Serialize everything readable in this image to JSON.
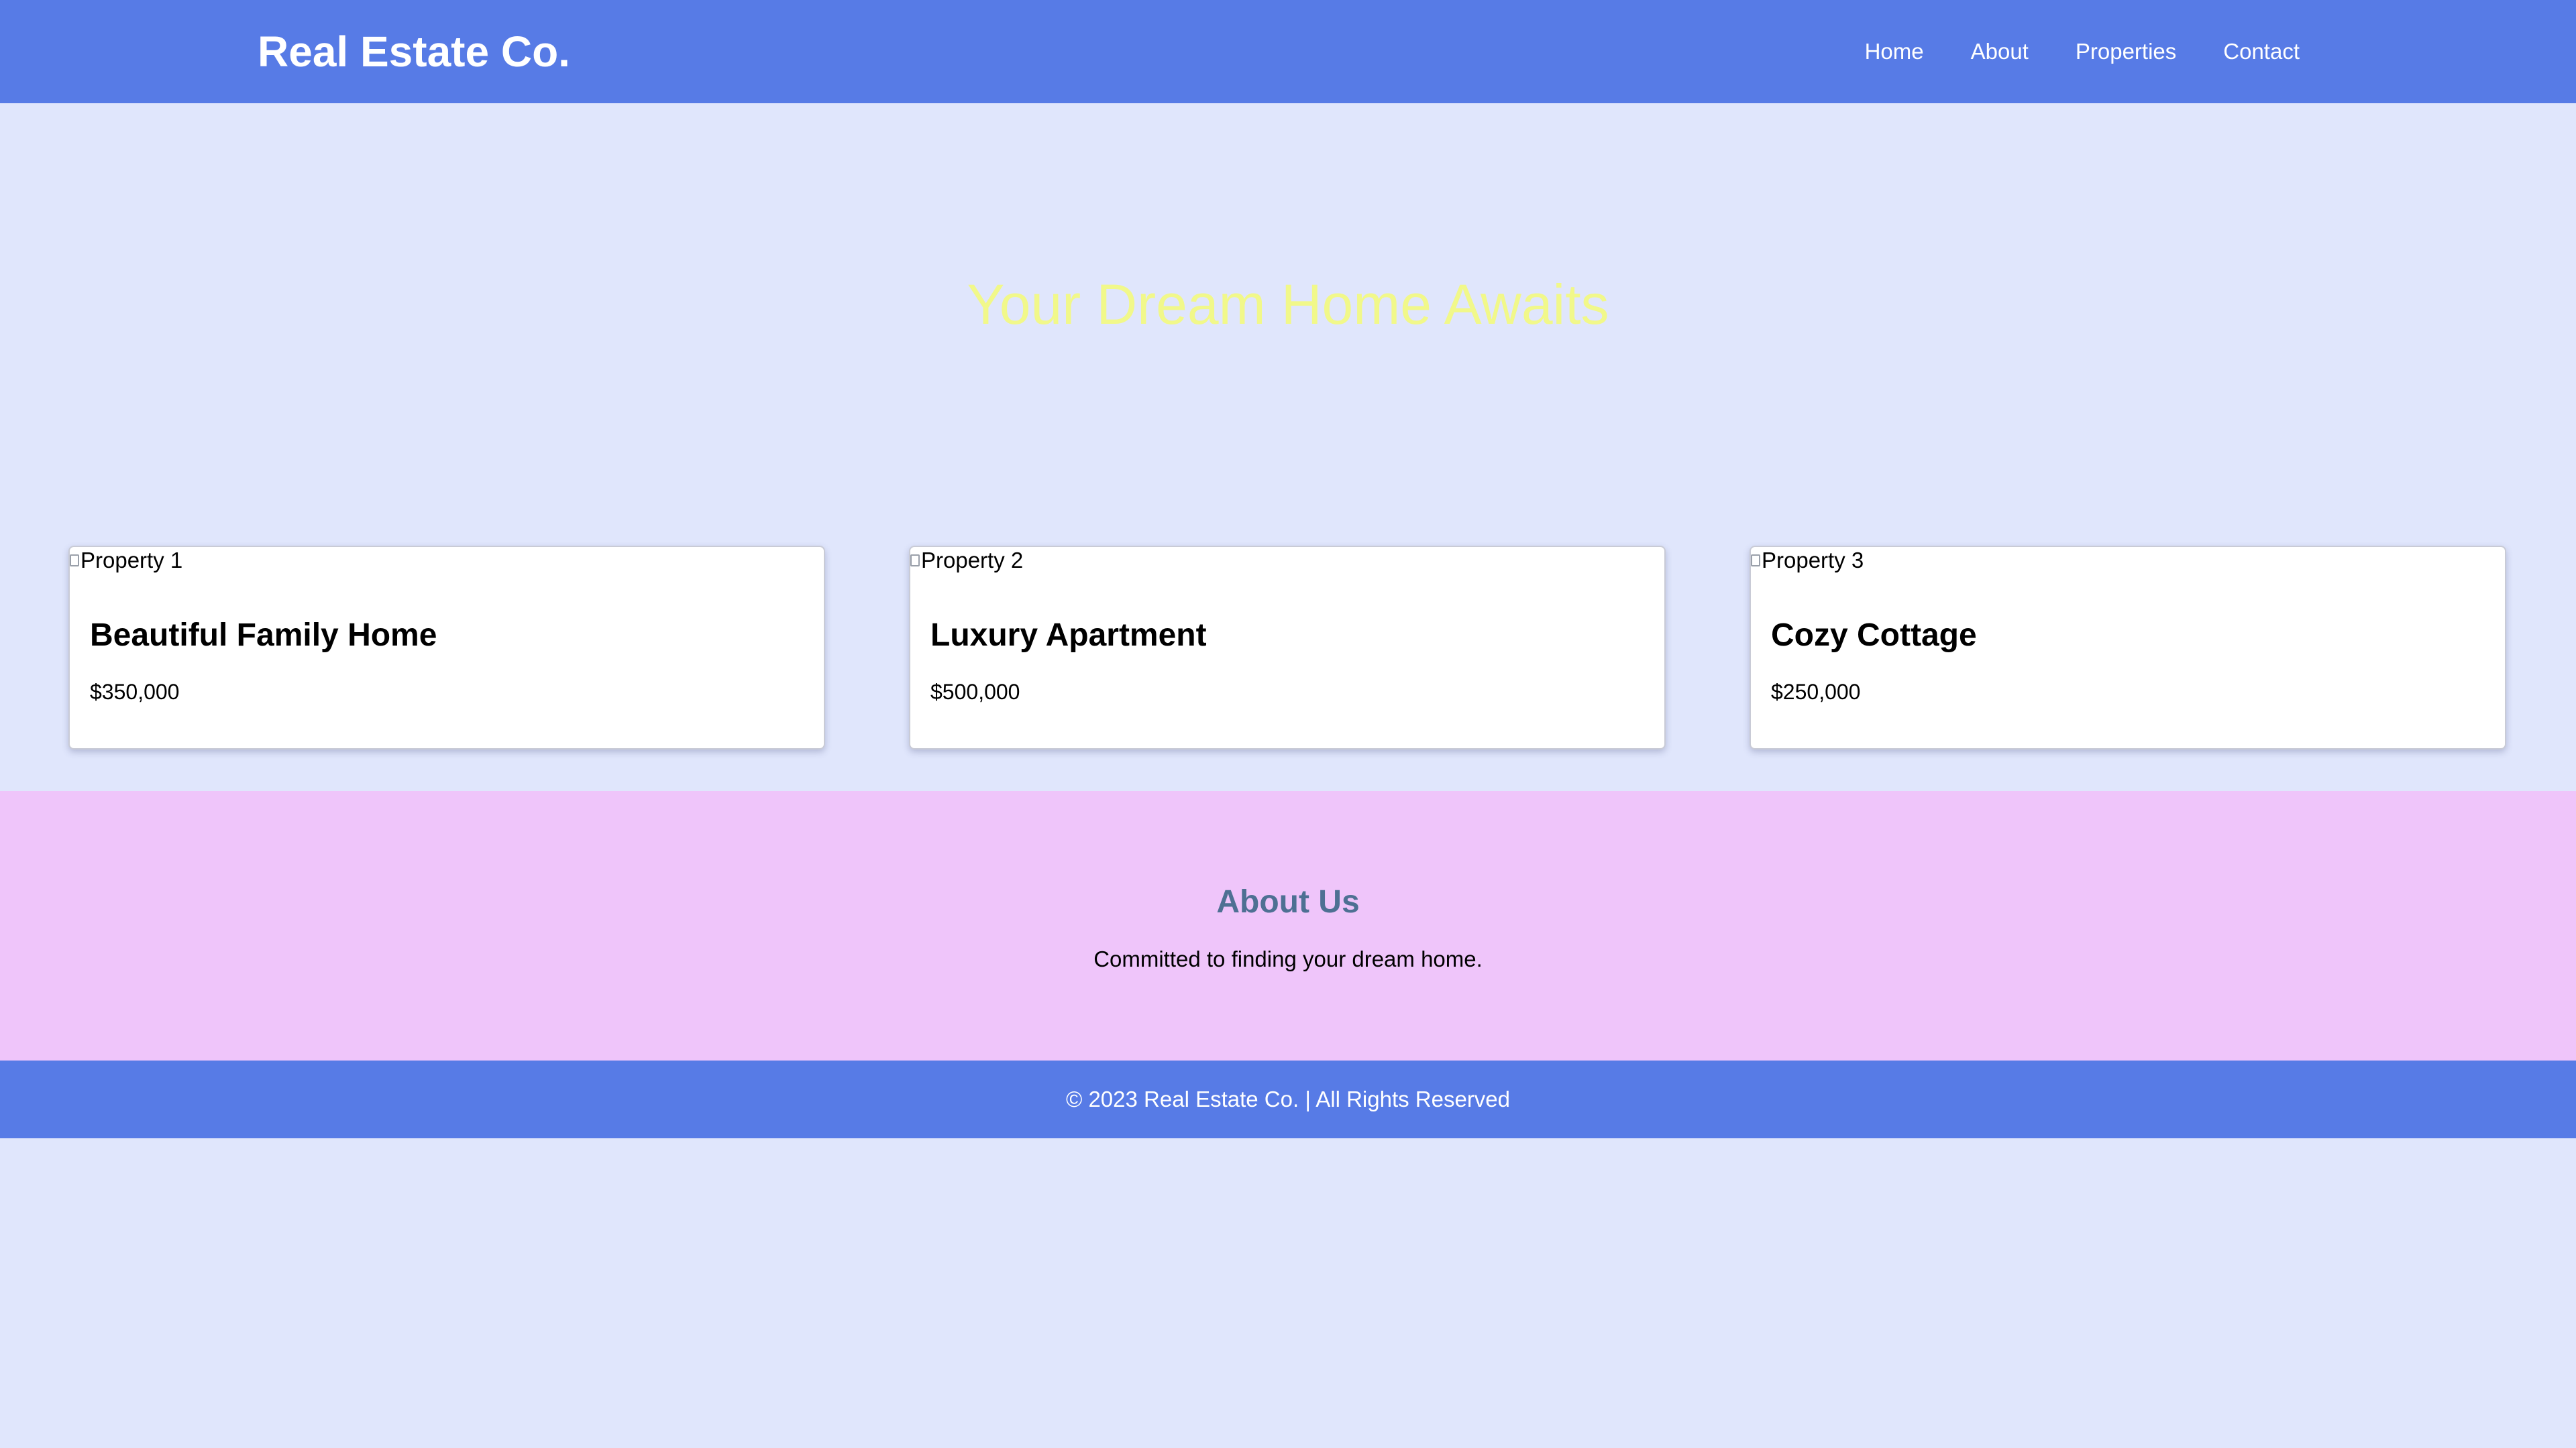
{
  "header": {
    "brand": "Real Estate Co.",
    "nav": [
      "Home",
      "About",
      "Properties",
      "Contact"
    ]
  },
  "hero": {
    "title": "Your Dream Home Awaits"
  },
  "properties": [
    {
      "image_alt": "Property 1",
      "title": "Beautiful Family Home",
      "price": "$350,000"
    },
    {
      "image_alt": "Property 2",
      "title": "Luxury Apartment",
      "price": "$500,000"
    },
    {
      "image_alt": "Property 3",
      "title": "Cozy Cottage",
      "price": "$250,000"
    }
  ],
  "about": {
    "title": "About Us",
    "text": "Committed to finding your dream home."
  },
  "footer": {
    "text": "© 2023 Real Estate Co. | All Rights Reserved"
  },
  "colors": {
    "header_bg": "#577be6",
    "page_bg": "#e0e6fc",
    "hero_text": "#f1f88a",
    "about_bg": "#efc5fa",
    "about_title": "#4e7093"
  },
  "icons": {
    "card_image": "broken-image-icon"
  }
}
